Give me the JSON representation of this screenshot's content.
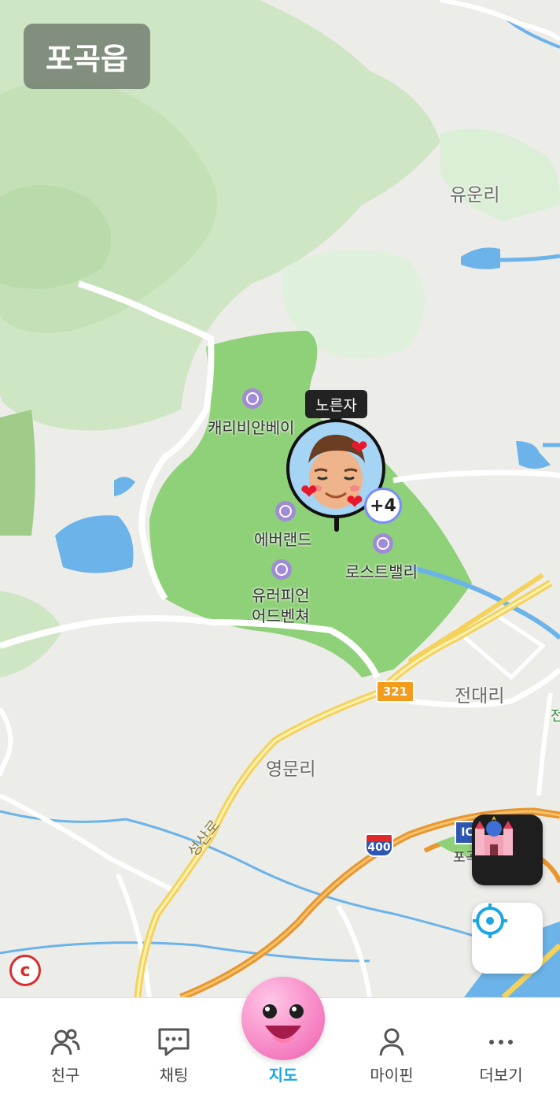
{
  "map": {
    "region": "포곡읍",
    "villages": [
      "유운리",
      "전대리",
      "영문리"
    ],
    "places": [
      "캐리비안베이",
      "에버랜드",
      "로스트밸리",
      "유러피언\n어드벤쳐"
    ],
    "places_lines": {
      "euro_line1": "유러피언",
      "euro_line2": "어드벤쳐"
    },
    "road_name": "성산로",
    "route_number": "321",
    "highway_number": "400",
    "ic_sign": "IC",
    "ic_text": "포곡",
    "edge_text": "전"
  },
  "friend_marker": {
    "name": "노른자",
    "extra_count": "+4",
    "heart_icon": "heart-icon"
  },
  "controls": {
    "castle_icon": "castle-icon",
    "locate_icon": "crosshair-icon",
    "compass_glyph": "c"
  },
  "tabs": [
    {
      "label": "친구",
      "icon": "friends-icon"
    },
    {
      "label": "채팅",
      "icon": "chat-icon"
    },
    {
      "label": "지도",
      "icon": "map-character-icon",
      "active": true
    },
    {
      "label": "마이핀",
      "icon": "person-icon"
    },
    {
      "label": "더보기",
      "icon": "more-icon"
    }
  ],
  "colors": {
    "park_green": "#8fd178",
    "forest_green": "#cfe8c8",
    "water": "#6bb3e8",
    "active_tab": "#1aa7e8",
    "highway": "#e8962e"
  }
}
